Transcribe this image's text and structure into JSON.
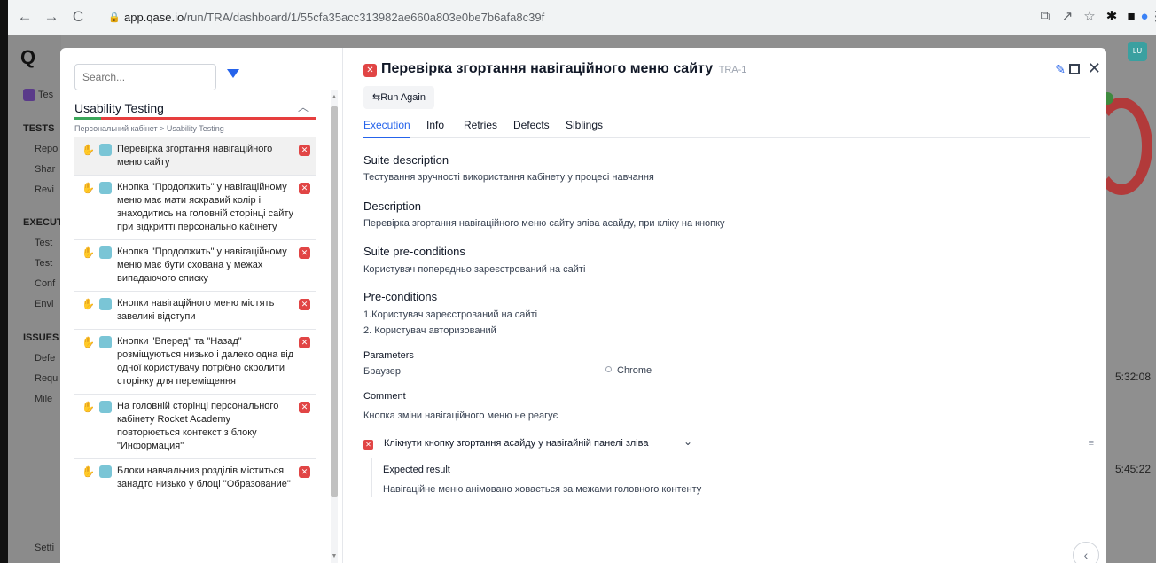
{
  "browser": {
    "url_domain": "app.qase.io",
    "url_path": "/run/TRA/dashboard/1/55cfa35acc313982ae660a803e0be7b6afa8c39f",
    "back": "←",
    "forward": "→",
    "reload": "C"
  },
  "app": {
    "logo": "Q",
    "user_initials": "LU",
    "sidebar": {
      "project": "Tes",
      "tests_header": "TESTS",
      "tests_items": [
        "Repo",
        "Shar",
        "Revi"
      ],
      "execution_header": "EXECUTI",
      "execution_items": [
        "Test",
        "Test",
        "Conf",
        "Envi"
      ],
      "issues_header": "ISSUES",
      "issues_items": [
        "Defe",
        "Requ",
        "Mile"
      ],
      "settings": "Setti"
    },
    "bg_times": [
      "5:32:08",
      "5:45:22"
    ]
  },
  "list": {
    "search_placeholder": "Search...",
    "suite_title": "Usability Testing",
    "breadcrumb": "Персональний кабінет > Usability Testing",
    "cases": [
      "Перевірка згортання навігаційного меню сайту",
      "Кнопка \"Продолжить\" у навігаційному меню має мати яскравий колір і знаходитись на головній сторінці сайту при відкритті персонально кабінету",
      "Кнопка \"Продолжить\" у навігаційному меню має бути схована у межах випадаючого списку",
      "Кнопки навігаційного меню містять завеликі відступи",
      "Кнопки \"Вперед\" та \"Назад\" розміщуються низько і далеко одна від одної користувачу потрібно скролити сторінку для переміщення",
      "На головній сторінці персонального кабінету Rocket Academy повторюється контекст з блоку \"Информация\"",
      "Блоки навчальниз розділів міститься занадто низько у блоці \"Образование\""
    ]
  },
  "detail": {
    "title": "Перевірка згортання навігаційного меню сайту",
    "case_id": "TRA-1",
    "run_again": "Run Again",
    "tabs": [
      "Execution",
      "Info",
      "Retries",
      "Defects",
      "Siblings"
    ],
    "suite_description_label": "Suite description",
    "suite_description": "Тестування зручності використання кабінету у процесі навчання",
    "description_label": "Description",
    "description": "Перевірка згортання навігаційного меню сайту зліва асайду, при кліку на кнопку",
    "suite_preconditions_label": "Suite pre-conditions",
    "suite_preconditions": "Користувач попередньо зареєстрований на сайті",
    "preconditions_label": "Pre-conditions",
    "preconditions": [
      "1.Користувач зареєстрований на сайті",
      "2. Користувач авторизований"
    ],
    "parameters_label": "Parameters",
    "param_name": "Браузер",
    "param_value": "Chrome",
    "comment_label": "Comment",
    "comment": "Кнопка зміни навігаційного меню не реагує",
    "step": "Клікнути кнопку згортання асайду у навігайній панелі зліва",
    "expected_label": "Expected result",
    "expected": "Навігаційне меню анімовано ховається за межами головного контенту"
  }
}
